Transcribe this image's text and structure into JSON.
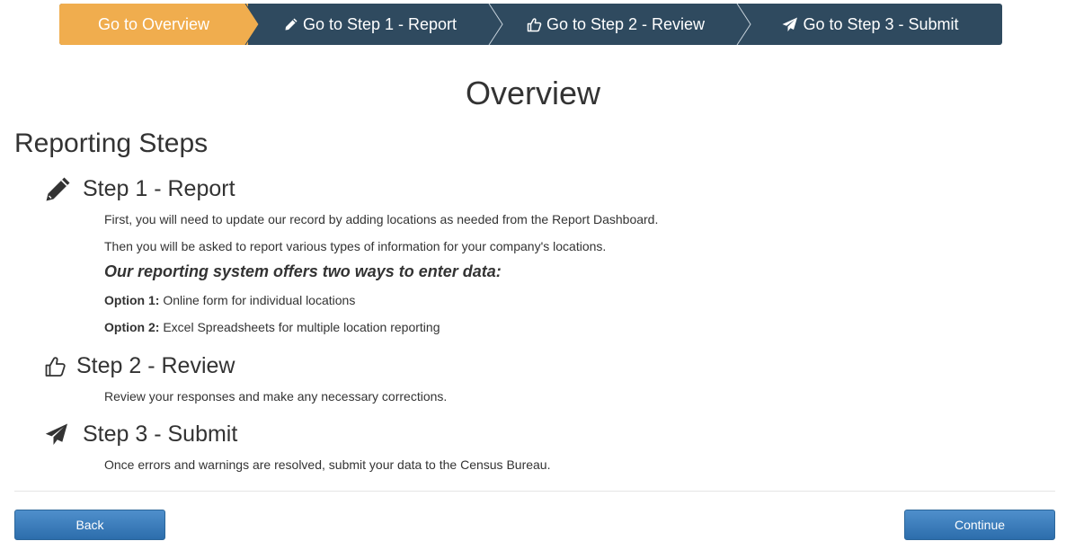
{
  "wizard": {
    "steps": [
      {
        "label": "Go to Overview",
        "icon": "none"
      },
      {
        "label": "Go to Step 1 - Report",
        "icon": "pencil-icon"
      },
      {
        "label": "Go to Step 2 - Review",
        "icon": "thumbs-up-icon"
      },
      {
        "label": "Go to Step 3 - Submit",
        "icon": "paper-plane-icon"
      }
    ],
    "active_color": "#f0ad4e",
    "inactive_color": "#2f4a5f"
  },
  "page_title": "Overview",
  "section_title": "Reporting Steps",
  "steps": [
    {
      "title": "Step 1 - Report",
      "icon": "pencil-icon",
      "lines": [
        "First, you will need to update our record by adding locations as needed from the Report Dashboard.",
        "Then you will be asked to report various types of information for your company's locations."
      ],
      "emphasis": "Our reporting system offers two ways to enter data:",
      "options": [
        {
          "label": "Option 1:",
          "text": " Online form for individual locations"
        },
        {
          "label": "Option 2:",
          "text": " Excel Spreadsheets for multiple location reporting"
        }
      ]
    },
    {
      "title": "Step 2 - Review",
      "icon": "thumbs-up-icon",
      "lines": [
        "Review your responses and make any necessary corrections."
      ]
    },
    {
      "title": "Step 3 - Submit",
      "icon": "paper-plane-icon",
      "lines": [
        "Once errors and warnings are resolved, submit your data to the Census Bureau."
      ]
    }
  ],
  "buttons": {
    "back": "Back",
    "continue": "Continue"
  }
}
